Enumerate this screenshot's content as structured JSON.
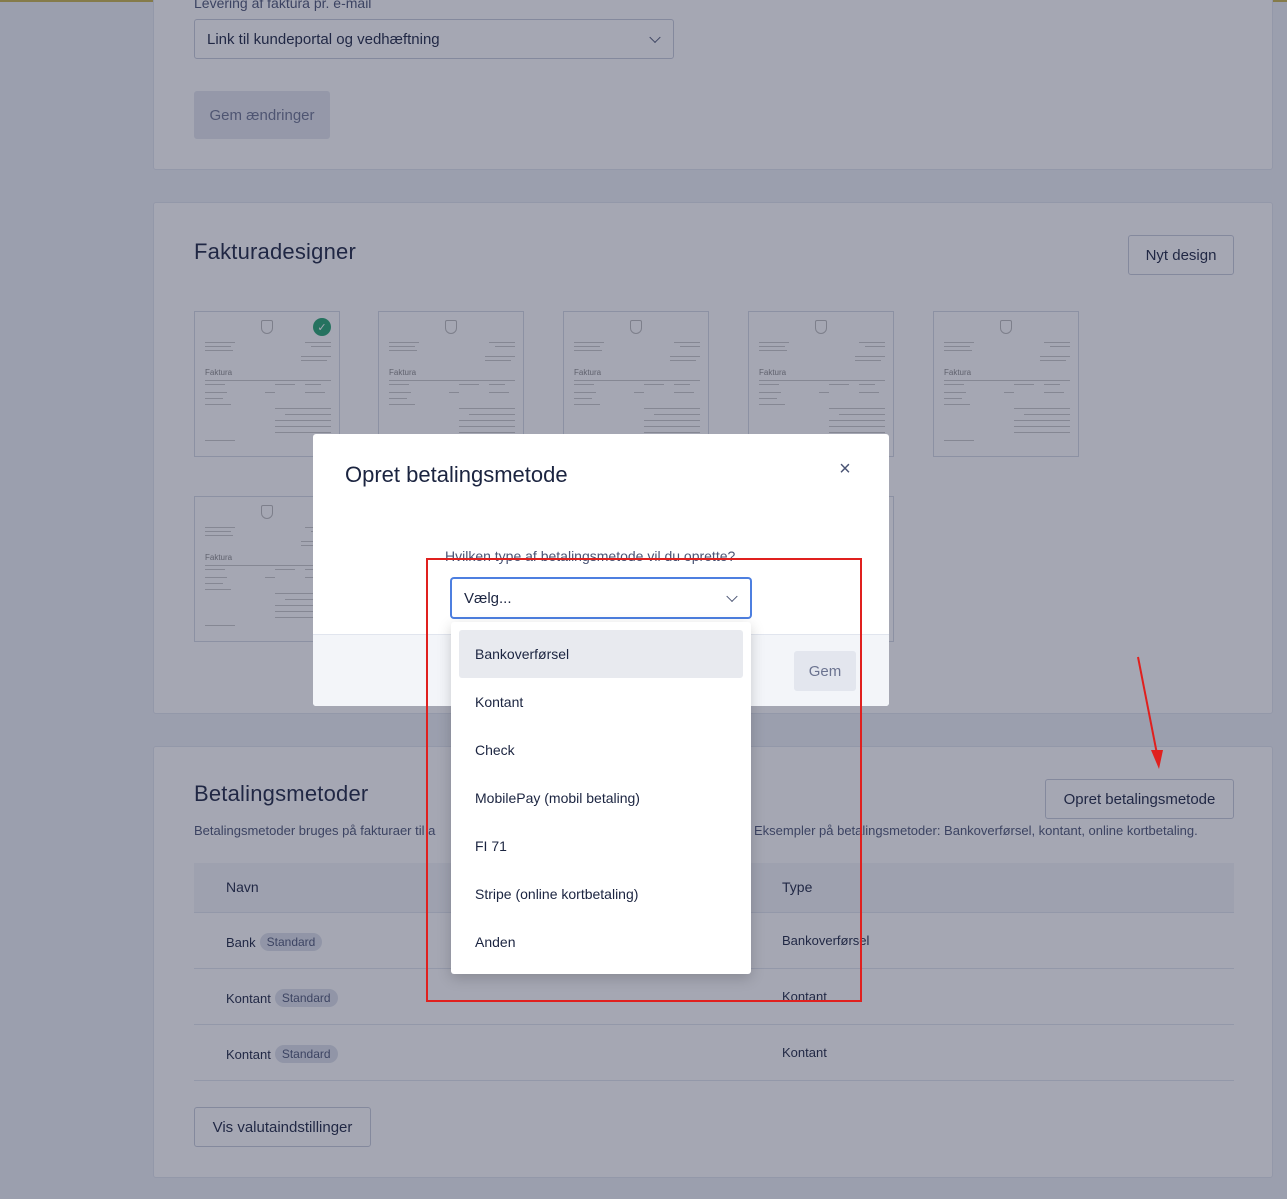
{
  "delivery": {
    "label": "Levering af faktura pr. e-mail",
    "selected": "Link til kundeportal og vedhæftning",
    "save_button": "Gem ændringer"
  },
  "invoice_designs": {
    "title": "Fakturadesigner",
    "new_button": "Nyt design",
    "thumbnail_heading": "Faktura",
    "selected_index": 0
  },
  "payment_methods": {
    "title": "Betalingsmetoder",
    "create_button": "Opret betalingsmetode",
    "description_left": "Betalingsmetoder bruges på fakturaer til a",
    "description_right": "Eksempler på betalingsmetoder: Bankoverførsel, kontant, online kortbetaling.",
    "columns": [
      "Navn",
      "Type"
    ],
    "rows": [
      {
        "name": "Bank",
        "badge": "Standard",
        "type": "Bankoverførsel"
      },
      {
        "name": "Kontant",
        "badge": "Standard",
        "type": "Kontant"
      },
      {
        "name": "Kontant",
        "badge": "Standard",
        "type": "Kontant"
      }
    ],
    "currency_button": "Vis valutaindstillinger"
  },
  "modal": {
    "title": "Opret betalingsmetode",
    "close": "×",
    "question": "Hvilken type af betalingsmetode vil du oprette?",
    "select_value": "Vælg...",
    "save_button": "Gem",
    "options": [
      "Bankoverførsel",
      "Kontant",
      "Check",
      "MobilePay (mobil betaling)",
      "FI 71",
      "Stripe (online kortbetaling)",
      "Anden"
    ],
    "highlighted_option_index": 0
  },
  "annotation_color": "#e0201e"
}
